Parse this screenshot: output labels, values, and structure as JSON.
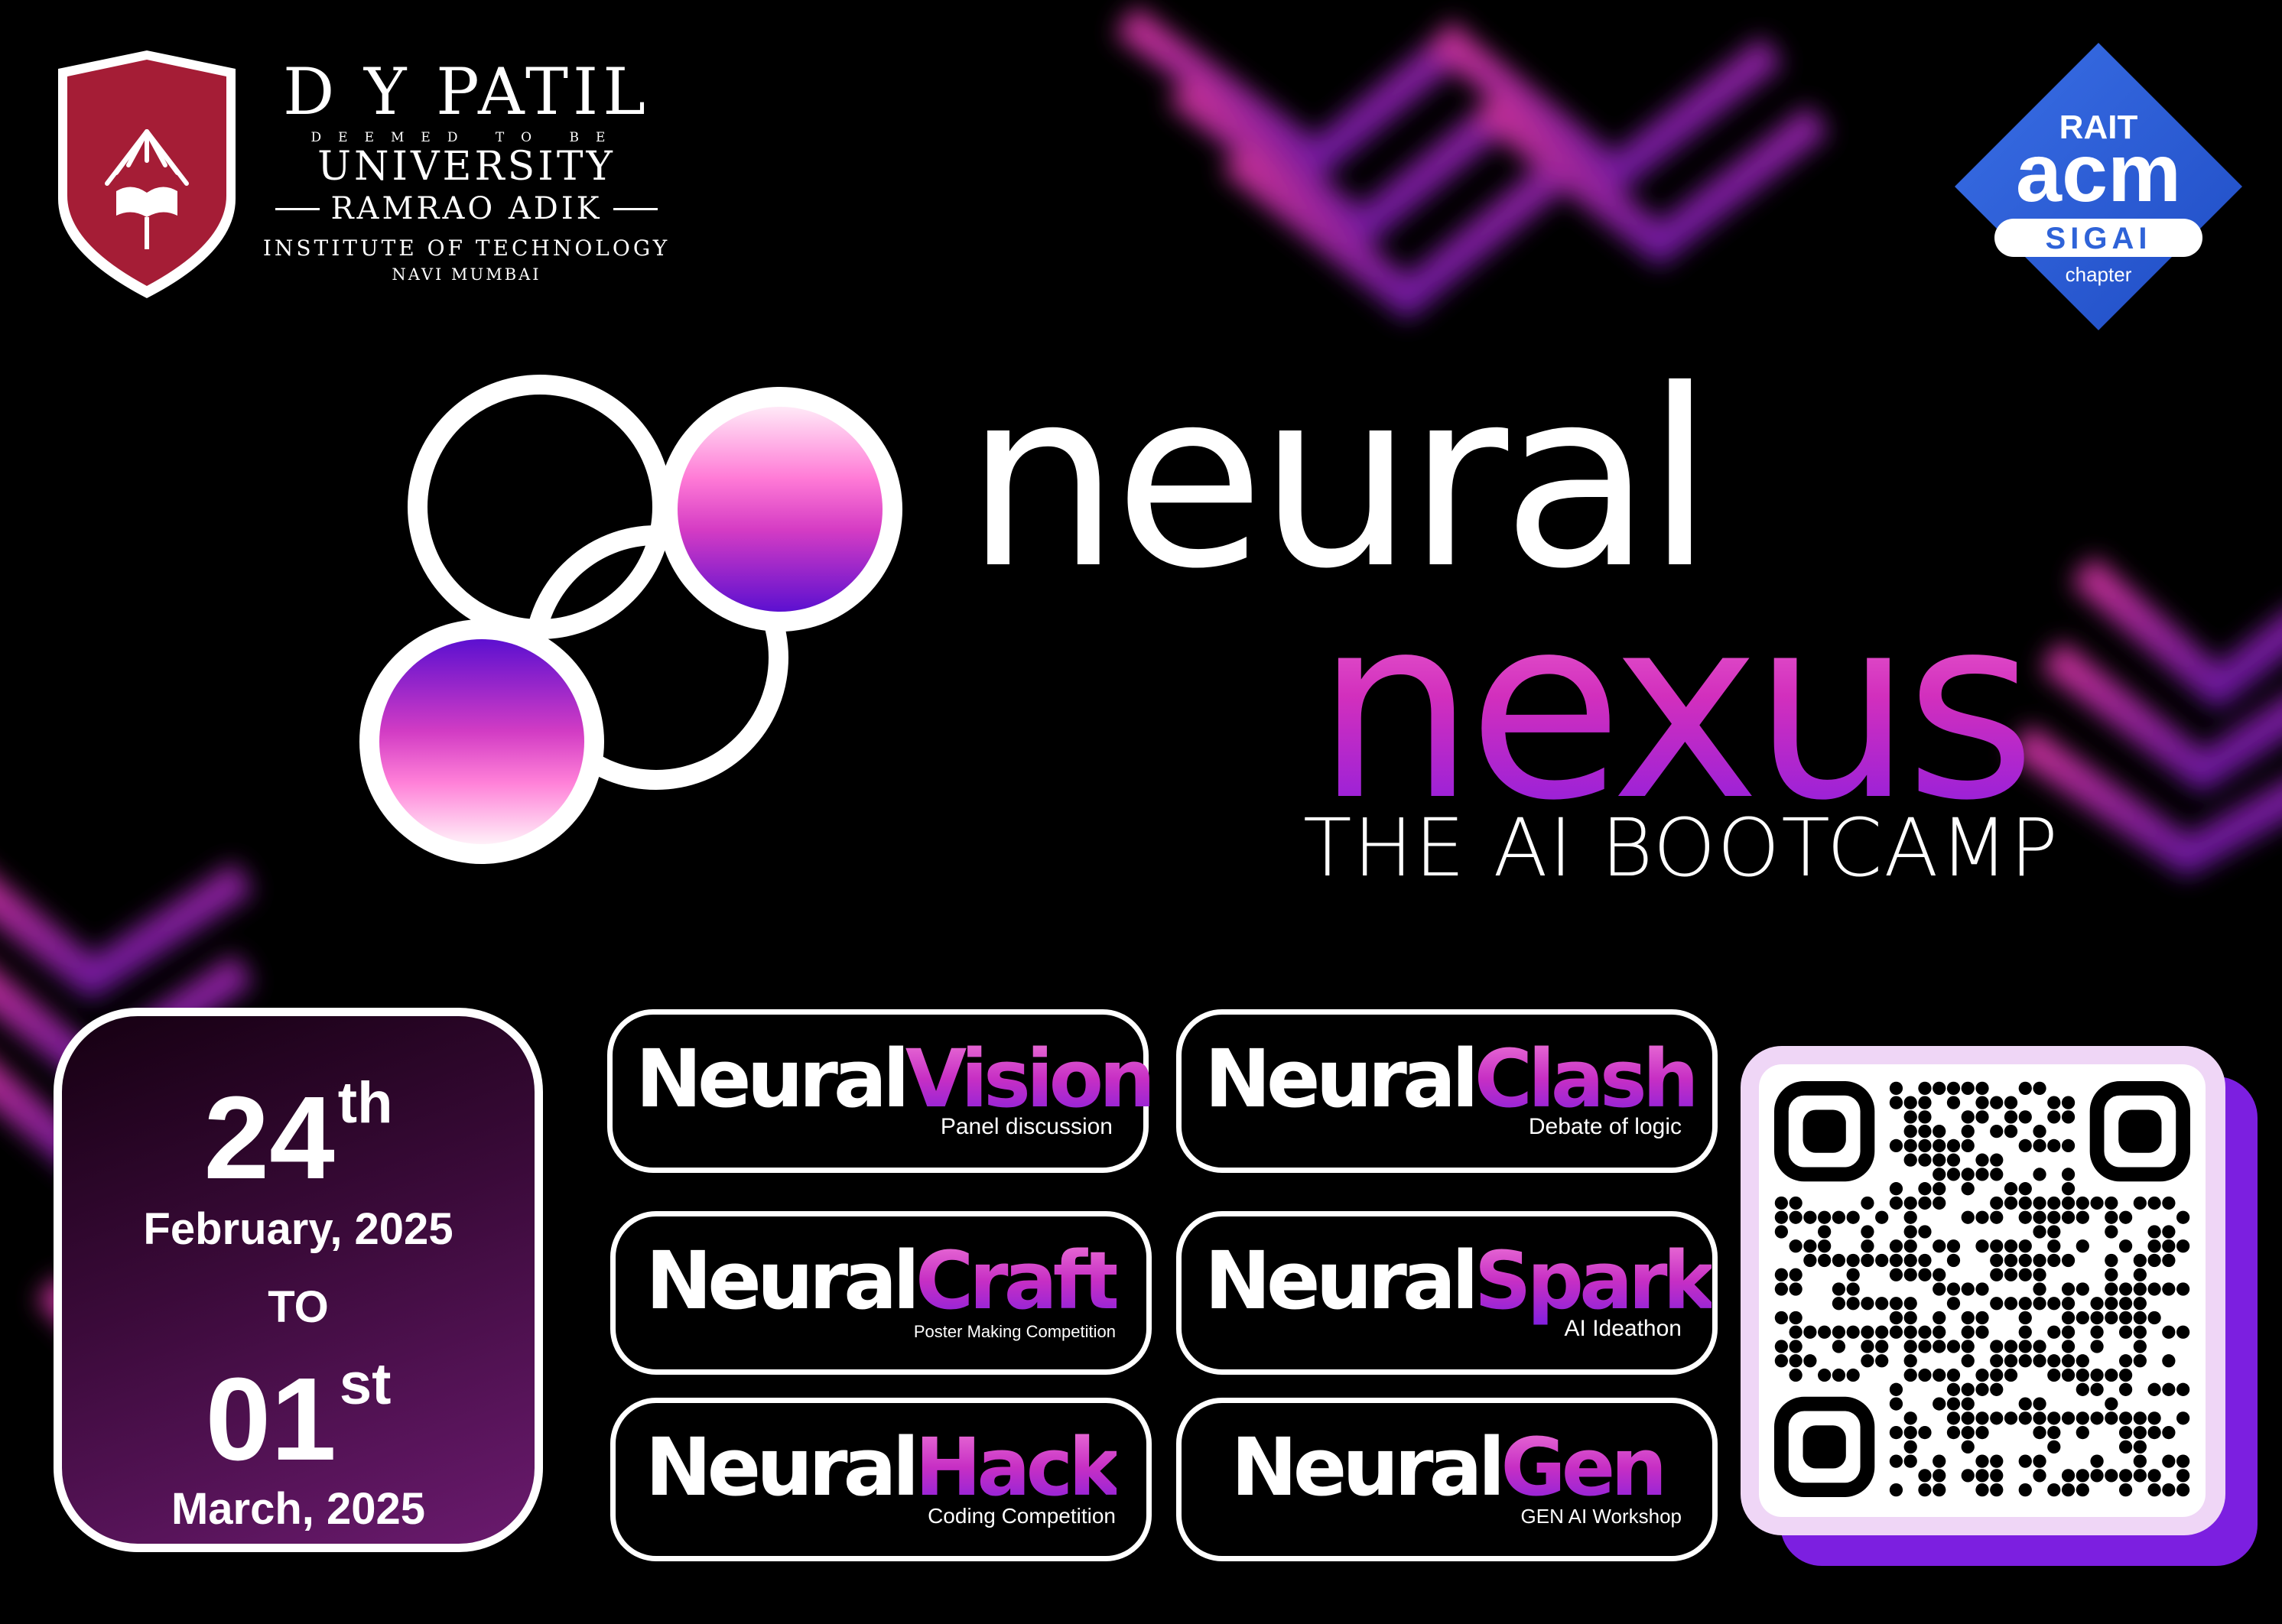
{
  "institution": {
    "name": "D Y PATIL",
    "tagline": "DEEMED TO BE",
    "university": "UNIVERSITY",
    "college": "RAMRAO ADIK",
    "subtitle": "INSTITUTE OF TECHNOLOGY",
    "city": "NAVI MUMBAI",
    "crest_icon": "open-book-sunburst-crest"
  },
  "chapter_logo": {
    "top": "RAIT",
    "main": "acm",
    "badge": "SIGAI",
    "bottom": "chapter",
    "color": "#2f63d8"
  },
  "event": {
    "title_line1": "neural",
    "title_line2": "nexus",
    "subtitle": "THE AI BOOTCAMP",
    "logo_icon": "two-circles-gradient-logo"
  },
  "dates": {
    "start_day": "24",
    "start_suffix": "th",
    "start_month": "February, 2025",
    "separator": "TO",
    "end_day": "01",
    "end_suffix": "st",
    "end_month": "March, 2025"
  },
  "events": [
    {
      "prefix": "Neural",
      "name": "Vision",
      "desc": "Panel discussion"
    },
    {
      "prefix": "Neural",
      "name": "Clash",
      "desc": "Debate of logic"
    },
    {
      "prefix": "Neural",
      "name": "Craft",
      "desc": "Poster Making Competition"
    },
    {
      "prefix": "Neural",
      "name": "Spark",
      "desc": "AI Ideathon"
    },
    {
      "prefix": "Neural",
      "name": "Hack",
      "desc": "Coding Competition"
    },
    {
      "prefix": "Neural",
      "name": "Gen",
      "desc": "GEN AI Workshop"
    }
  ],
  "qr": {
    "icon": "registration-qr-code"
  },
  "colors": {
    "background": "#000000",
    "accent_pink": "#e23fc6",
    "accent_purple": "#7f1fe0",
    "crest_red": "#a51d36"
  }
}
